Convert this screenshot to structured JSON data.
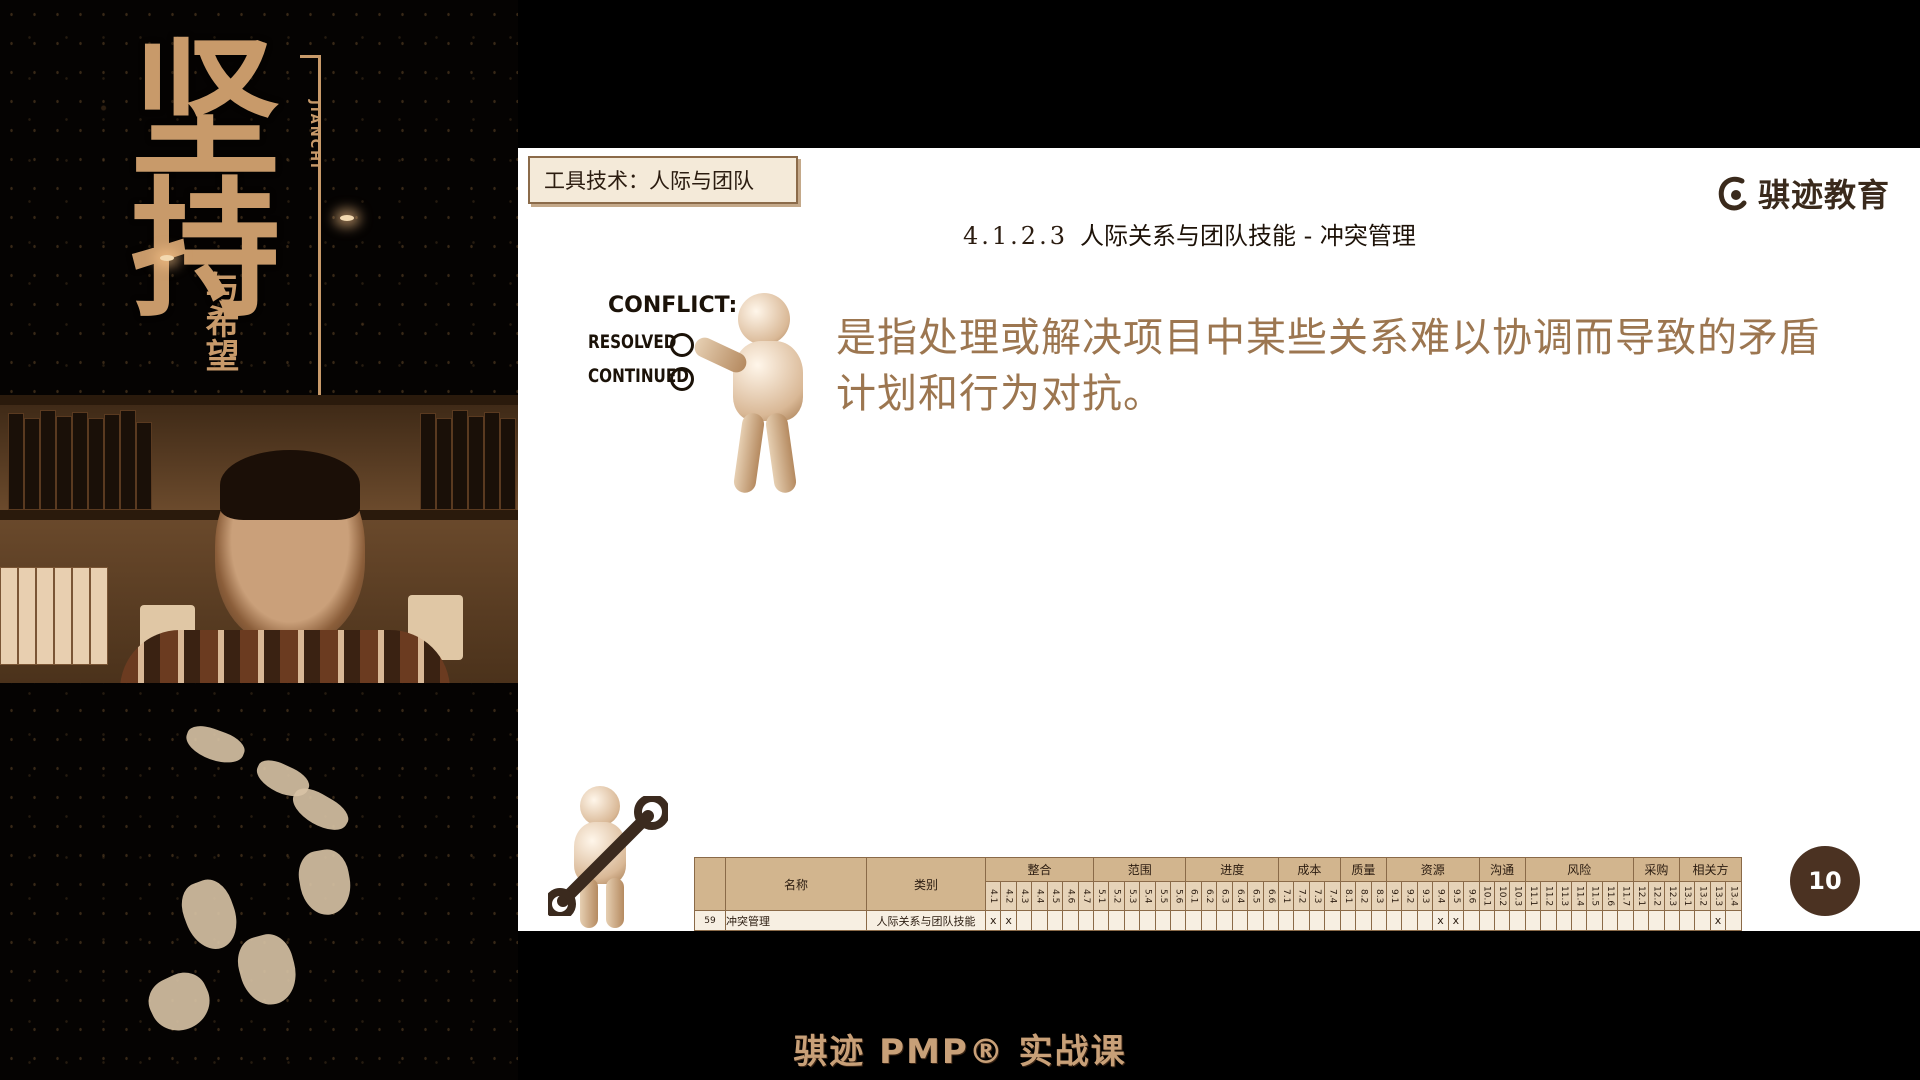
{
  "poster": {
    "title": "坚持",
    "subtitle": "与希望",
    "pinyin": "JIANCHI"
  },
  "slide": {
    "topic_tab": "工具技术：人际与团队",
    "logo_text": "骐迹教育",
    "section_number": "4.1.2.3",
    "section_title": "人际关系与团队技能 - 冲突管理",
    "definition": "是指处理或解决项目中某些关系难以协调而导致的矛盾计划和行为对抗。",
    "conflict_graphic": {
      "title": "CONFLICT:",
      "option1": "RESOLVED",
      "option2": "CONTINUED"
    },
    "page_number": "10",
    "table": {
      "header_name": "名称",
      "header_category": "类别",
      "groups": [
        {
          "label": "整合",
          "subs": [
            "4.1",
            "4.2",
            "4.3",
            "4.4",
            "4.5",
            "4.6",
            "4.7"
          ]
        },
        {
          "label": "范围",
          "subs": [
            "5.1",
            "5.2",
            "5.3",
            "5.4",
            "5.5",
            "5.6"
          ]
        },
        {
          "label": "进度",
          "subs": [
            "6.1",
            "6.2",
            "6.3",
            "6.4",
            "6.5",
            "6.6"
          ]
        },
        {
          "label": "成本",
          "subs": [
            "7.1",
            "7.2",
            "7.3",
            "7.4"
          ]
        },
        {
          "label": "质量",
          "subs": [
            "8.1",
            "8.2",
            "8.3"
          ]
        },
        {
          "label": "资源",
          "subs": [
            "9.1",
            "9.2",
            "9.3",
            "9.4",
            "9.5",
            "9.6"
          ]
        },
        {
          "label": "沟通",
          "subs": [
            "10.1",
            "10.2",
            "10.3"
          ]
        },
        {
          "label": "风险",
          "subs": [
            "11.1",
            "11.2",
            "11.3",
            "11.4",
            "11.5",
            "11.6",
            "11.7"
          ]
        },
        {
          "label": "采购",
          "subs": [
            "12.1",
            "12.2",
            "12.3"
          ]
        },
        {
          "label": "相关方",
          "subs": [
            "13.1",
            "13.2",
            "13.3",
            "13.4"
          ]
        }
      ],
      "row": {
        "index": "59",
        "name": "冲突管理",
        "category": "人际关系与团队技能",
        "marks": [
          "4.1",
          "4.2",
          "9.4",
          "9.5",
          "13.3"
        ]
      }
    }
  },
  "caption": "骐迹 PMP® 实战课",
  "colors": {
    "accent": "#9c7650",
    "badge": "#4b3222",
    "caption": "#c8a078"
  }
}
